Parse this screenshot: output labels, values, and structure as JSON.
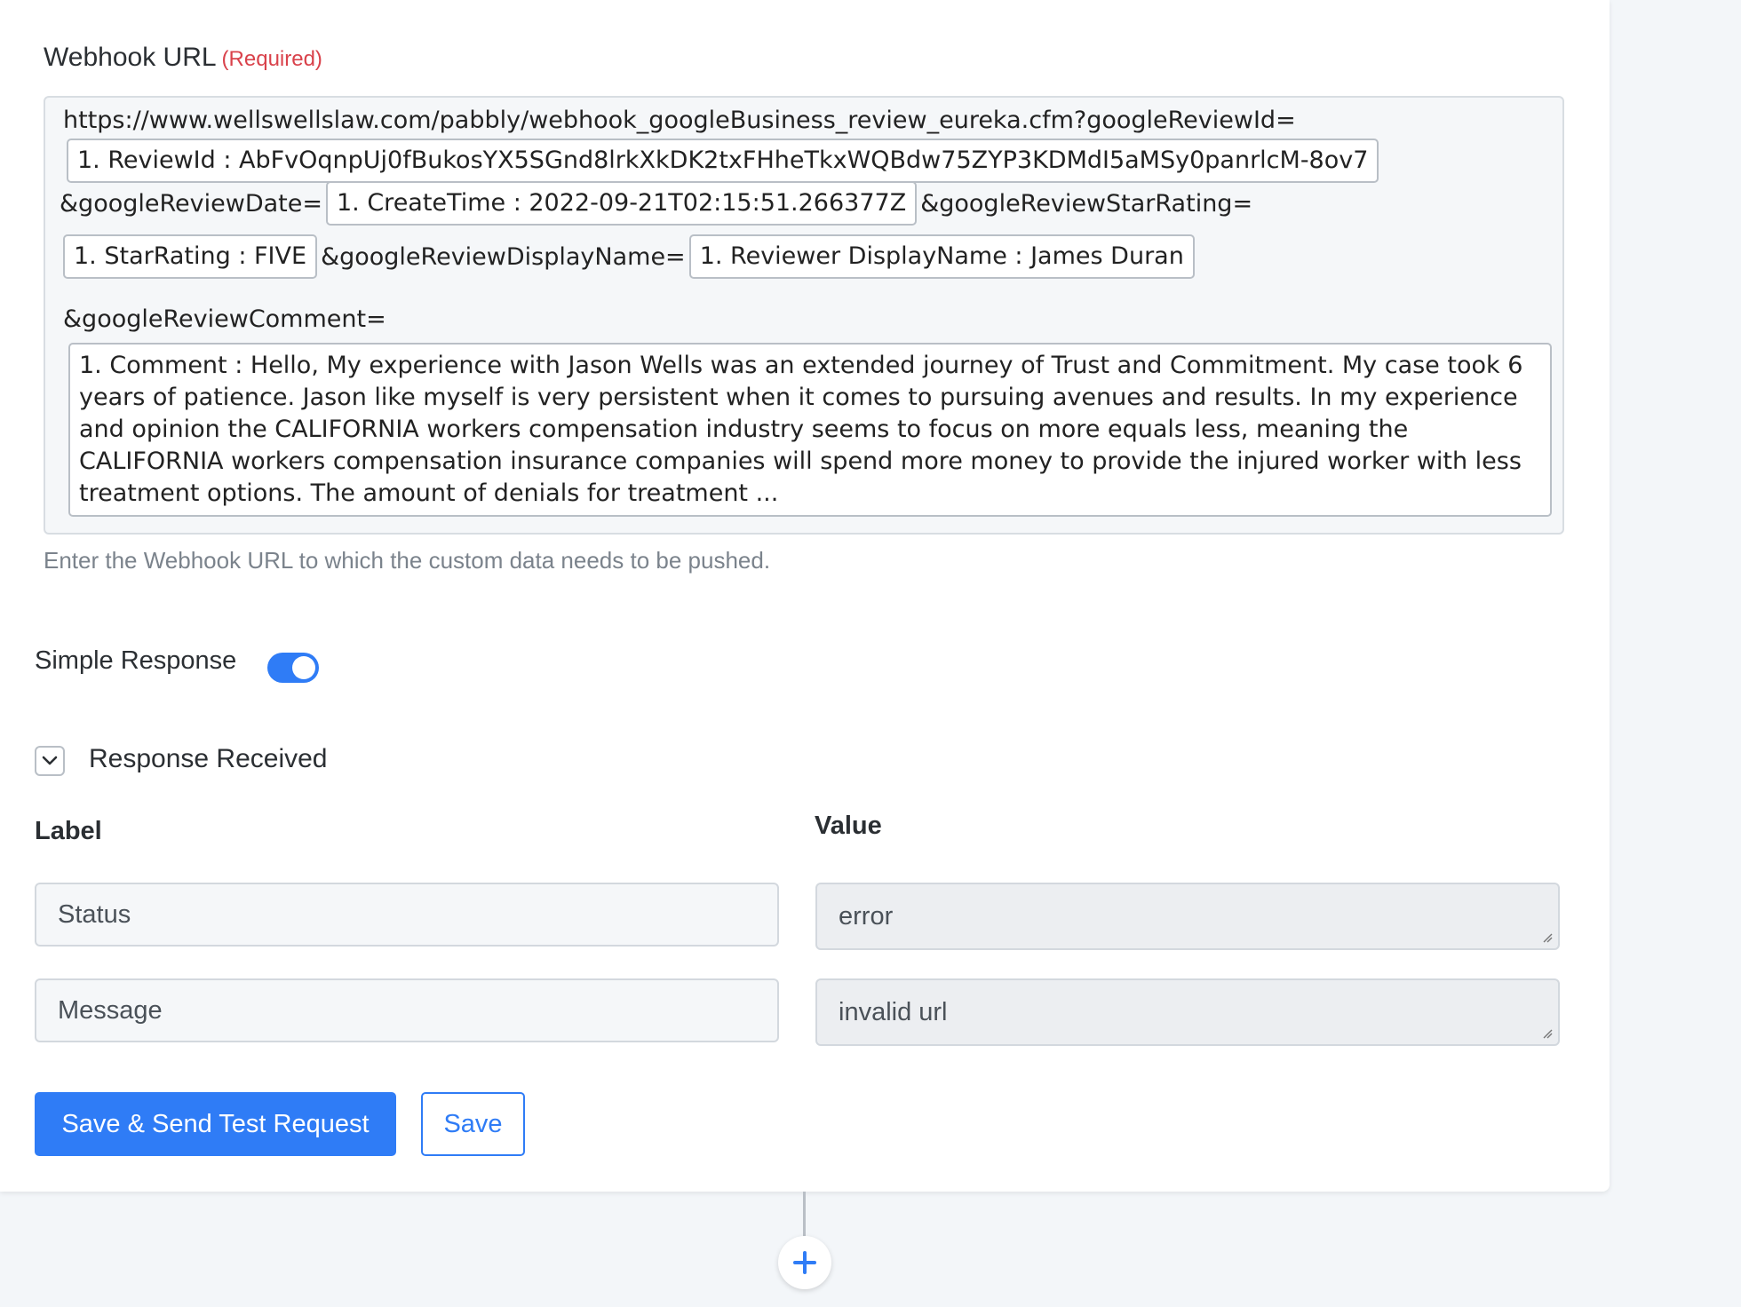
{
  "webhook": {
    "title": "Webhook URL",
    "required": "(Required)",
    "help": "Enter the Webhook URL to which the custom data needs to be pushed.",
    "segments": {
      "base": "https://www.wellswellslaw.com/pabbly/webhook_googleBusiness_review_eureka.cfm?googleReviewId=",
      "review_id_pill": "1. ReviewId : AbFvOqnpUj0fBukosYX5SGnd8lrkXkDK2txFHheTkxWQBdw75ZYP3KDMdI5aMSy0panrlcM-8ov7",
      "date_param": "&googleReviewDate=",
      "create_time_pill": "1. CreateTime : 2022-09-21T02:15:51.266377Z",
      "star_param": "&googleReviewStarRating=",
      "star_pill": "1. StarRating : FIVE",
      "name_param": "&googleReviewDisplayName=",
      "name_pill": "1. Reviewer DisplayName : James Duran",
      "comment_param": "&googleReviewComment=",
      "comment_pill": "1. Comment : Hello, My experience with Jason Wells was an extended journey of Trust and Commitment. My case took 6 years of patience. Jason like myself is very persistent when it comes to pursuing avenues and results. In my experience and opinion the CALIFORNIA workers compensation industry seems to focus on more equals less, meaning the CALIFORNIA workers compensation insurance companies will spend more money to provide the injured worker with less treatment options. The amount of denials for treatment ..."
    }
  },
  "simple_response": {
    "label": "Simple Response",
    "enabled": true
  },
  "response_received": {
    "title": "Response Received",
    "label_header": "Label",
    "value_header": "Value",
    "rows": [
      {
        "label": "Status",
        "value": "error"
      },
      {
        "label": "Message",
        "value": "invalid url"
      }
    ]
  },
  "actions": {
    "save_test_label": "Save & Send Test Request",
    "save_label": "Save"
  },
  "colors": {
    "accent": "#2f7cf6",
    "required": "#d9424b"
  },
  "icons": {
    "collapse": "chevron-down-icon",
    "add_step": "plus-icon"
  }
}
